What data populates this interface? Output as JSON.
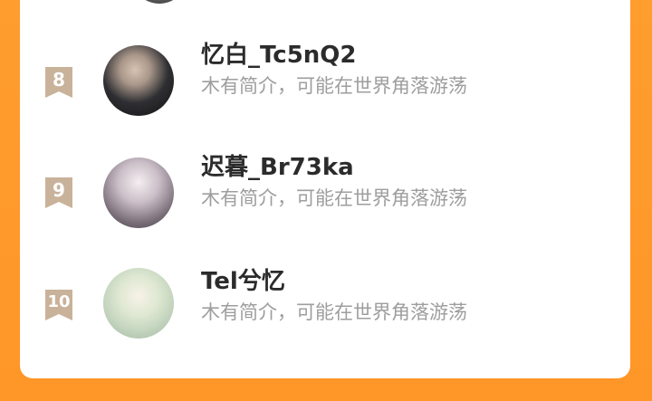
{
  "colors": {
    "background": "#ff9a2e",
    "card": "#ffffff",
    "badge": "#c9b29a",
    "name": "#2b2b2b",
    "bio": "#9e9e9e"
  },
  "rows": [
    {
      "rank": "8",
      "name": "忆白_Tc5nQ2",
      "bio": "木有简介，可能在世界角落游荡"
    },
    {
      "rank": "9",
      "name": "迟暮_Br73ka",
      "bio": "木有简介，可能在世界角落游荡"
    },
    {
      "rank": "10",
      "name": "Tel兮忆",
      "bio": "木有简介，可能在世界角落游荡"
    }
  ]
}
